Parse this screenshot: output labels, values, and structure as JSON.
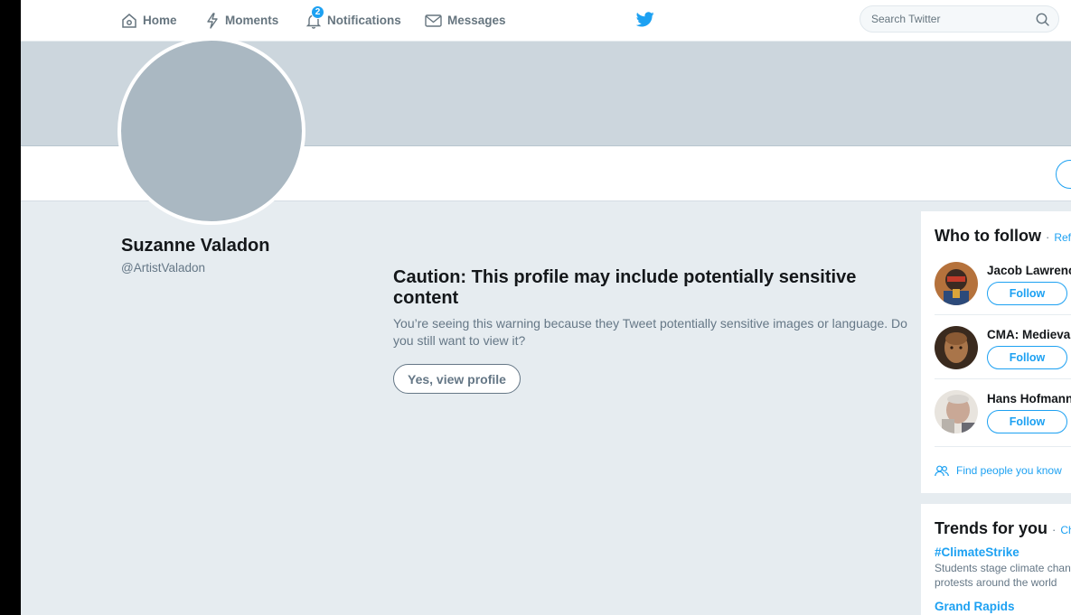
{
  "nav": {
    "home": "Home",
    "moments": "Moments",
    "notifications": "Notifications",
    "notifications_badge": "2",
    "messages": "Messages"
  },
  "search": {
    "placeholder": "Search Twitter"
  },
  "profile": {
    "name": "Suzanne Valadon",
    "handle": "@ArtistValadon"
  },
  "caution": {
    "title": "Caution: This profile may include potentially sensitive content",
    "text": "You’re seeing this warning because they Tweet potentially sensitive images or language. Do you still want to view it?",
    "button": "Yes, view profile"
  },
  "who_to_follow": {
    "title": "Who to follow",
    "separator": "·",
    "refresh": "Refresh",
    "follow_label": "Follow",
    "users": [
      {
        "name": "Jacob Lawrence"
      },
      {
        "name": "CMA: Medieval"
      },
      {
        "name": "Hans Hofmann"
      }
    ],
    "find_people": "Find people you know"
  },
  "trends": {
    "title": "Trends for you",
    "separator": "·",
    "change": "Change",
    "items": [
      {
        "name": "#ClimateStrike",
        "desc": "Students stage climate change protests around the world"
      },
      {
        "name": "Grand Rapids"
      }
    ]
  },
  "colors": {
    "accent": "#1da1f2",
    "page_bg": "#e6ecf0",
    "banner": "#ccd6dd",
    "avatar_placeholder": "#aab8c2"
  }
}
